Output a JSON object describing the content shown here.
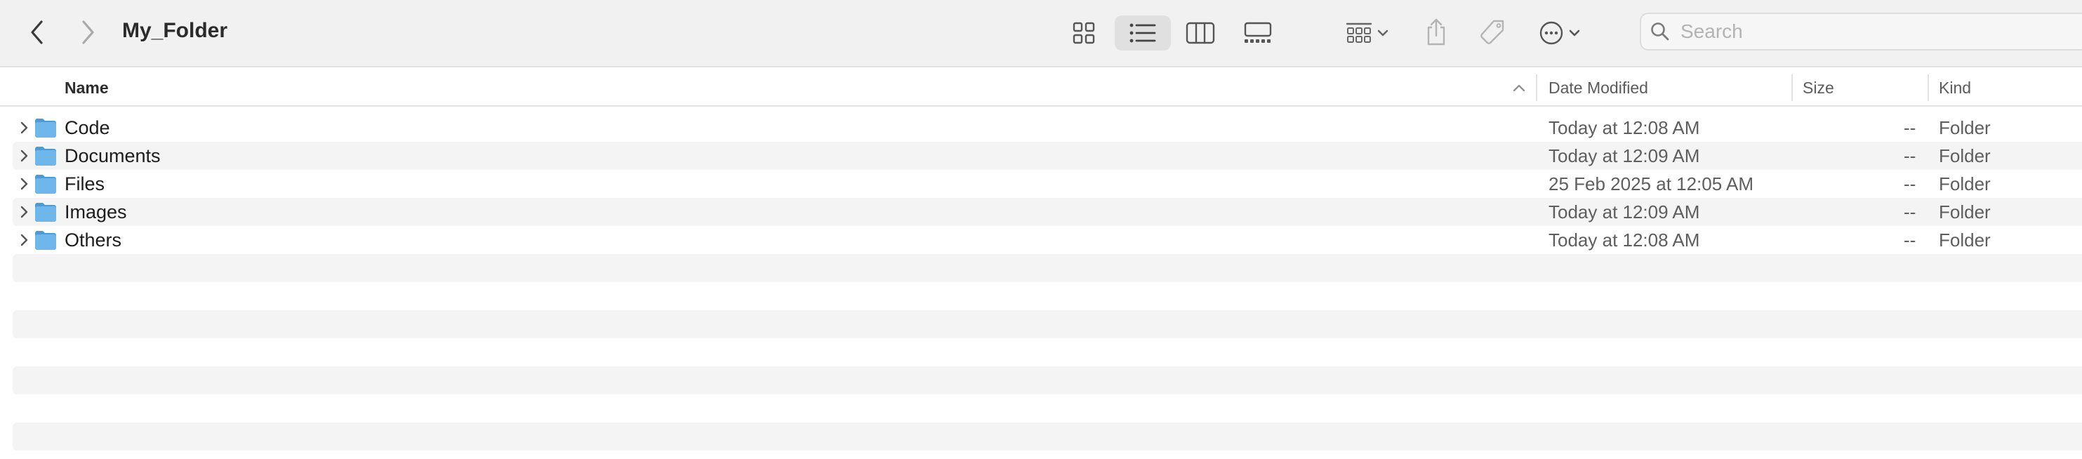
{
  "window": {
    "title": "My_Folder",
    "back_icon": "chevron-left-icon",
    "forward_icon": "chevron-right-icon"
  },
  "toolbar": {
    "views": [
      {
        "name": "icon-view",
        "icon": "grid-icon",
        "active": false
      },
      {
        "name": "list-view",
        "icon": "list-icon",
        "active": true
      },
      {
        "name": "column-view",
        "icon": "columns-icon",
        "active": false
      },
      {
        "name": "gallery-view",
        "icon": "gallery-icon",
        "active": false
      }
    ],
    "group_icon": "group-grid-icon",
    "share_icon": "share-icon",
    "tag_icon": "tag-icon",
    "more_icon": "ellipsis-circle-icon",
    "search_placeholder": "Search"
  },
  "columns": {
    "name": "Name",
    "date_modified": "Date Modified",
    "size": "Size",
    "kind": "Kind"
  },
  "files": [
    {
      "name": "Code",
      "date_modified": "Today at 12:08 AM",
      "size": "--",
      "kind": "Folder"
    },
    {
      "name": "Documents",
      "date_modified": "Today at 12:09 AM",
      "size": "--",
      "kind": "Folder"
    },
    {
      "name": "Files",
      "date_modified": "25 Feb 2025 at 12:05 AM",
      "size": "--",
      "kind": "Folder"
    },
    {
      "name": "Images",
      "date_modified": "Today at 12:09 AM",
      "size": "--",
      "kind": "Folder"
    },
    {
      "name": "Others",
      "date_modified": "Today at 12:08 AM",
      "size": "--",
      "kind": "Folder"
    }
  ],
  "colors": {
    "toolbar_bg": "#f2f1f1",
    "stripe": "#f4f4f4",
    "folder_blue": "#6fb6ea",
    "folder_blue_dark": "#4a9bd8"
  }
}
